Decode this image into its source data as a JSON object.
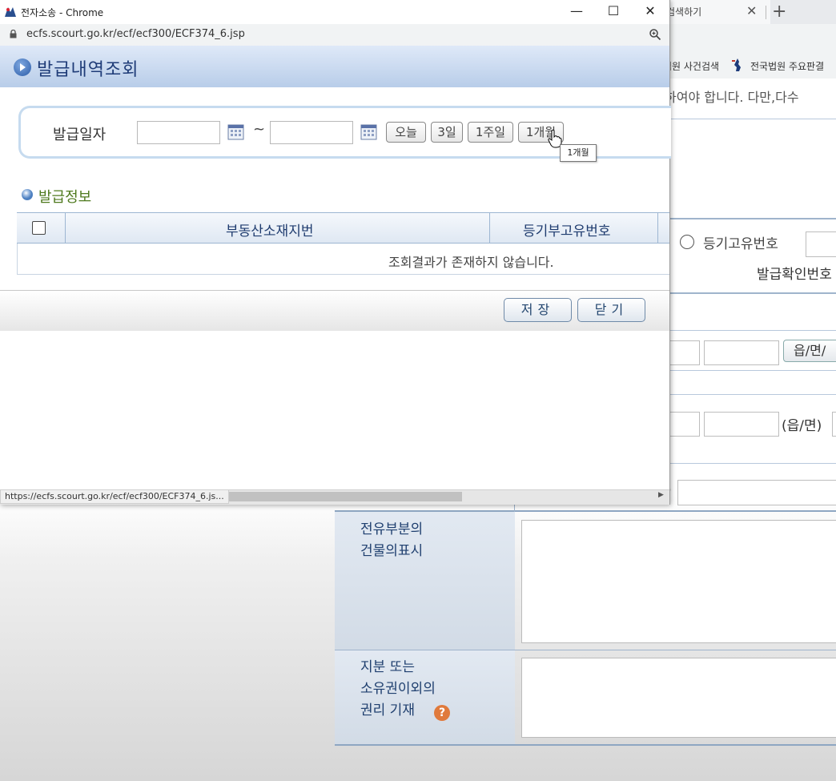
{
  "background": {
    "tab_title": "검색하기",
    "bookmarks": [
      "법원 사건검색",
      "전국법원 주요판결"
    ],
    "notice_text": "하여야 합니다. 다만,다수",
    "radio_label": "등기고유번호",
    "issue_confirm_label": "발급확인번호",
    "district_button": "읍/면/",
    "district_label": "(읍/면)",
    "paren_label": ")",
    "row_exclusive": "전유부분의\n건물의표시",
    "row_share": "지분 또는\n소유권이외의\n권리 기재",
    "help_icon": "question-icon"
  },
  "popup": {
    "window_title": "전자소송 - Chrome",
    "url": "ecfs.scourt.go.kr/ecf/ecf300/ECF374_6.jsp",
    "page_title": "발급내역조회",
    "search": {
      "date_label": "발급일자",
      "from_value": "",
      "tilde": "~",
      "to_value": "",
      "quick_buttons": [
        "오늘",
        "3일",
        "1주일",
        "1개월"
      ]
    },
    "tooltip": "1개월",
    "section_title": "발급정보",
    "table": {
      "headers": [
        "부동산소재지번",
        "등기부고유번호"
      ],
      "empty_message": "조회결과가 존재하지 않습니다."
    },
    "buttons": {
      "save": "저장",
      "close": "닫기"
    },
    "status_url": "https://ecfs.scourt.go.kr/ecf/ecf300/ECF374_6.js..."
  },
  "colors": {
    "header_gradient_top": "#dfe9f8",
    "header_gradient_bottom": "#b8cde9",
    "title_blue": "#1f3c78",
    "section_green": "#4f7a1f"
  }
}
